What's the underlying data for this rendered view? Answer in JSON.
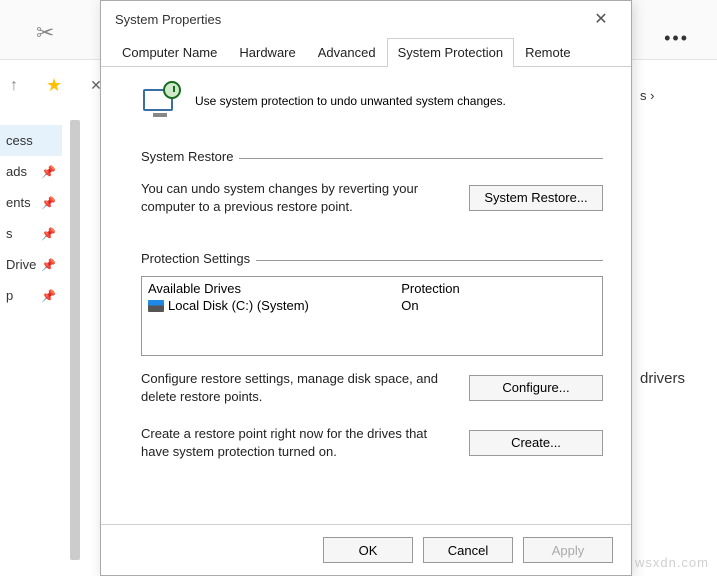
{
  "background": {
    "more": "•••",
    "sidebar": [
      "cess",
      "ads",
      "ents",
      "s",
      "Drive",
      "p"
    ],
    "crumb": "s  ›",
    "sidetext": "drivers",
    "watermark": "wsxdn.com"
  },
  "dialog": {
    "title": "System Properties",
    "tabs": [
      "Computer Name",
      "Hardware",
      "Advanced",
      "System Protection",
      "Remote"
    ],
    "active_tab": 3,
    "intro": "Use system protection to undo unwanted system changes.",
    "groups": {
      "restore": {
        "label": "System Restore",
        "text": "You can undo system changes by reverting your computer to a previous restore point.",
        "button": "System Restore..."
      },
      "protection": {
        "label": "Protection Settings",
        "col1": "Available Drives",
        "col2": "Protection",
        "drive_name": "Local Disk (C:) (System)",
        "drive_status": "On",
        "configure_text": "Configure restore settings, manage disk space, and delete restore points.",
        "configure_button": "Configure...",
        "create_text": "Create a restore point right now for the drives that have system protection turned on.",
        "create_button": "Create..."
      }
    },
    "footer": {
      "ok": "OK",
      "cancel": "Cancel",
      "apply": "Apply"
    }
  }
}
